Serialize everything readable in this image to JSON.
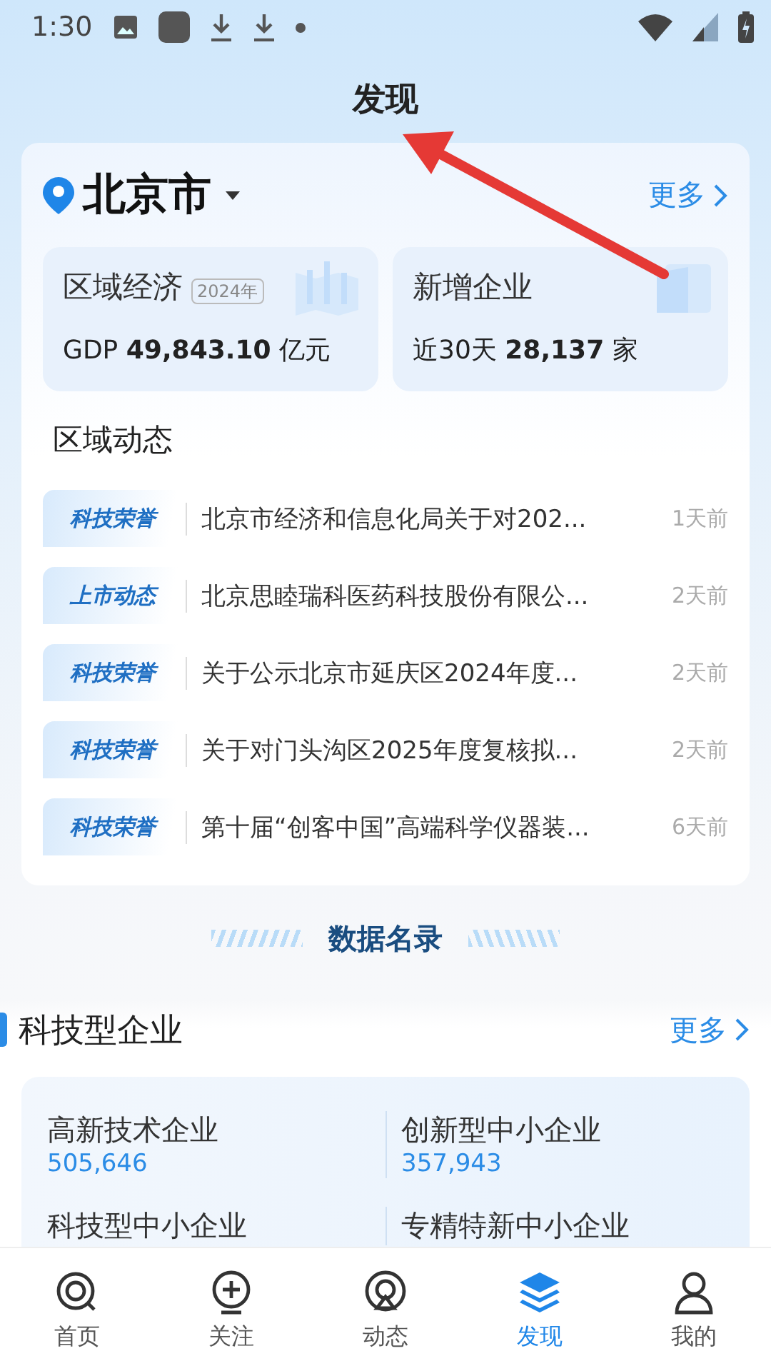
{
  "status_bar": {
    "time": "1:30"
  },
  "header": {
    "title": "发现"
  },
  "region_card": {
    "city": "北京市",
    "more": "更多",
    "stats": [
      {
        "title": "区域经济",
        "badge": "2024年",
        "prefix": "GDP",
        "value": "49,843.10",
        "unit": "亿元",
        "kind": "chart"
      },
      {
        "title": "新增企业",
        "prefix": "近30天",
        "value": "28,137",
        "unit": "家",
        "kind": "doc"
      }
    ],
    "news_title": "区域动态",
    "news": [
      {
        "tag": "科技荣誉",
        "title": "北京市经济和信息化局关于对202...",
        "time": "1天前"
      },
      {
        "tag": "上市动态",
        "title": "北京思睦瑞科医药科技股份有限公...",
        "time": "2天前"
      },
      {
        "tag": "科技荣誉",
        "title": "关于公示北京市延庆区2024年度...",
        "time": "2天前"
      },
      {
        "tag": "科技荣誉",
        "title": "关于对门头沟区2025年度复核拟...",
        "time": "2天前"
      },
      {
        "tag": "科技荣誉",
        "title": "第十届“创客中国”高端科学仪器装...",
        "time": "6天前"
      }
    ]
  },
  "directory": {
    "title": "数据名录"
  },
  "tech_section": {
    "title": "科技型企业",
    "more": "更多",
    "items": [
      {
        "name": "高新技术企业",
        "count": "505,646"
      },
      {
        "name": "创新型中小企业",
        "count": "357,943"
      },
      {
        "name": "科技型中小企业"
      },
      {
        "name": "专精特新中小企业"
      }
    ]
  },
  "tabs": [
    {
      "label": "首页",
      "kind": "home",
      "selected": false
    },
    {
      "label": "关注",
      "kind": "follow",
      "selected": false
    },
    {
      "label": "动态",
      "kind": "feed",
      "selected": false
    },
    {
      "label": "发现",
      "kind": "discover",
      "selected": true
    },
    {
      "label": "我的",
      "kind": "me",
      "selected": false
    }
  ],
  "annotation": {
    "kind": "arrow"
  }
}
